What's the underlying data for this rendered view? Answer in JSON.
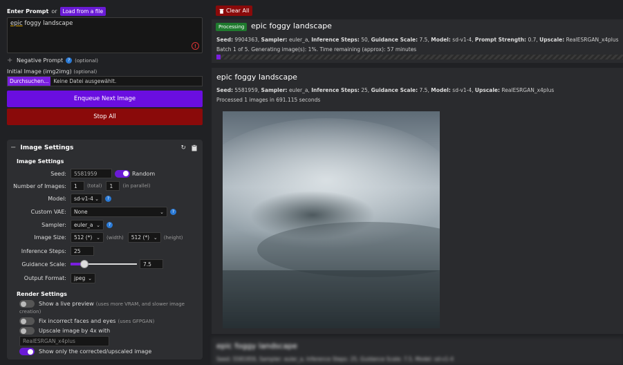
{
  "prompt_section": {
    "title": "Enter Prompt",
    "or": "or",
    "load_label": "Load from a file",
    "prompt_word1": "epic",
    "prompt_rest": " foggy landscape",
    "negative_label": "Negative Prompt",
    "optional": "(optional)",
    "init_label": "Initial Image (img2img)",
    "init_optional": "(optional)",
    "file_button": "Durchsuchen...",
    "file_status": "Keine Datei ausgewählt.",
    "enqueue_label": "Enqueue Next Image",
    "stop_label": "Stop All"
  },
  "image_settings": {
    "panel_title": "Image Settings",
    "section_title": "Image Settings",
    "seed_label": "Seed:",
    "seed_value": "5581959",
    "random_label": "Random",
    "num_images_label": "Number of Images:",
    "num_total": "1",
    "total_label": "(total)",
    "num_parallel": "1",
    "parallel_label": "(in parallel)",
    "model_label": "Model:",
    "model_value": "sd-v1-4",
    "vae_label": "Custom VAE:",
    "vae_value": "None",
    "sampler_label": "Sampler:",
    "sampler_value": "euler_a",
    "size_label": "Image Size:",
    "width_value": "512 (*)",
    "width_label": "(width)",
    "height_value": "512 (*)",
    "height_label": "(height)",
    "steps_label": "Inference Steps:",
    "steps_value": "25",
    "guidance_label": "Guidance Scale:",
    "guidance_value": "7.5",
    "guidance_fraction": 0.17,
    "format_label": "Output Format:",
    "format_value": "jpeg"
  },
  "render_settings": {
    "title": "Render Settings",
    "live_preview": "Show a live preview",
    "live_preview_note": "(uses more VRAM, and slower image",
    "live_preview_note2": "creation)",
    "fix_faces": "Fix incorrect faces and eyes",
    "fix_faces_note": "(uses GFPGAN)",
    "upscale": "Upscale image by 4x with",
    "upscale_model": "RealESRGAN_x4plus",
    "show_corrected": "Show only the corrected/upscaled image"
  },
  "output": {
    "clear_all": "Clear All",
    "task1": {
      "badge": "Processing",
      "title": "epic foggy landscape",
      "seed_label": "Seed:",
      "seed": "9904363,",
      "sampler_label": "Sampler:",
      "sampler": "euler_a,",
      "steps_label": "Inference Steps:",
      "steps": "50,",
      "guidance_label": "Guidance Scale:",
      "guidance": "7.5,",
      "model_label": "Model:",
      "model": "sd-v1-4,",
      "strength_label": "Prompt Strength:",
      "strength": "0.7,",
      "upscale_label": "Upscale:",
      "upscale": "RealESRGAN_x4plus",
      "status": "Batch 1 of 5. Generating image(s): 1%. Time remaining (approx): 57 minutes",
      "progress": 0.01
    },
    "task2": {
      "title": "epic foggy landscape",
      "seed_label": "Seed:",
      "seed": "5581959,",
      "sampler_label": "Sampler:",
      "sampler": "euler_a,",
      "steps_label": "Inference Steps:",
      "steps": "25,",
      "guidance_label": "Guidance Scale:",
      "guidance": "7.5,",
      "model_label": "Model:",
      "model": "sd-v1-4,",
      "upscale_label": "Upscale:",
      "upscale": "RealESRGAN_x4plus",
      "status": "Processed 1 images in 691.115 seconds"
    },
    "task3": {
      "title": "epic foggy landscape",
      "meta": "Seed: 5581959, Sampler: euler_a, Inference Steps: 25, Guidance Scale: 7.5, Model: sd-v1-4"
    }
  },
  "colors": {
    "accent": "#6a0ee0",
    "danger": "#8a0a0a",
    "processing": "#1f7a2e"
  }
}
